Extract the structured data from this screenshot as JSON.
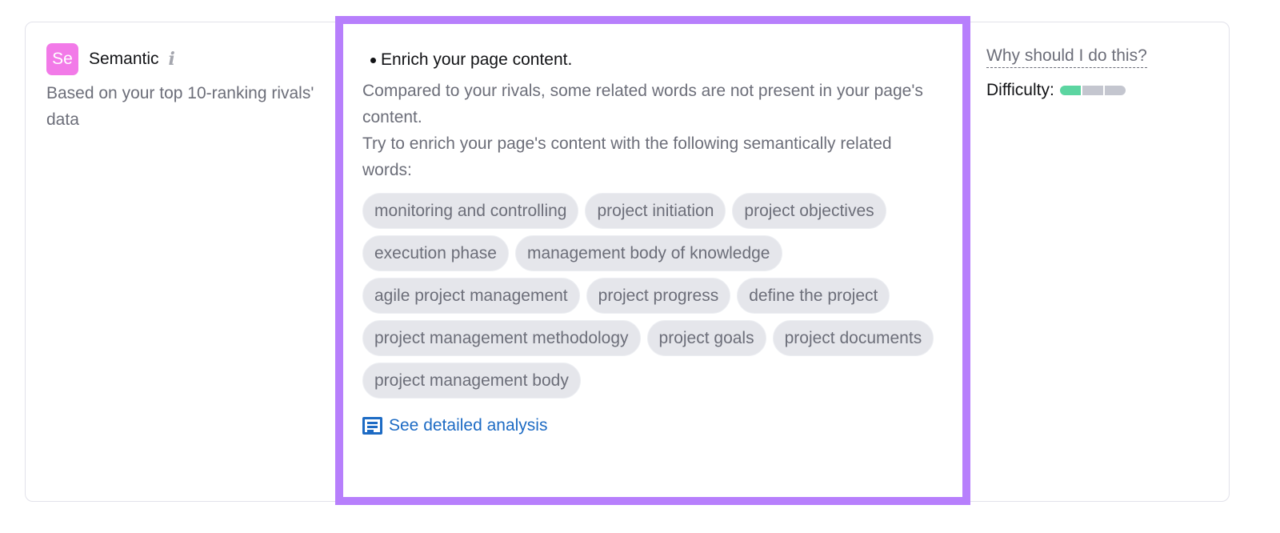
{
  "section": {
    "logo_text": "Se",
    "title": "Semantic",
    "info_icon": "info-icon",
    "subtitle": "Based on your top 10-ranking rivals' data"
  },
  "recommendation": {
    "heading": "Enrich your page content.",
    "description_1": "Compared to your rivals, some related words are not present in your page's content.",
    "description_2": "Try to enrich your page's content with the following semantically related words:",
    "words": [
      "monitoring and controlling",
      "project initiation",
      "project objectives",
      "execution phase",
      "management body of knowledge",
      "agile project management",
      "project progress",
      "define the project",
      "project management methodology",
      "project goals",
      "project documents",
      "project management body"
    ],
    "link_icon": "document-icon",
    "link_label": "See detailed analysis"
  },
  "side": {
    "why_label": "Why should I do this?",
    "difficulty_label": "Difficulty:",
    "difficulty_level": 1,
    "difficulty_max": 3
  },
  "colors": {
    "highlight": "#b77ffc",
    "logo": "#f27ae8",
    "link": "#1d6bc4",
    "difficulty_on": "#5cd5a1",
    "difficulty_off": "#c4c6cf"
  }
}
